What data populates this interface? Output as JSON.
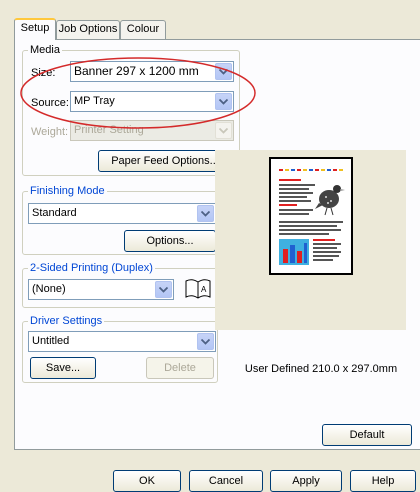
{
  "tabs": [
    "Setup",
    "Job Options",
    "Colour"
  ],
  "media": {
    "legend": "Media",
    "size_label": "Size:",
    "size_value": "Banner 297 x 1200 mm",
    "source_label": "Source:",
    "source_value": "MP Tray",
    "weight_label": "Weight:",
    "weight_value": "Printer Setting",
    "paper_feed_button": "Paper Feed Options..."
  },
  "finishing": {
    "legend": "Finishing Mode",
    "value": "Standard",
    "options_button": "Options..."
  },
  "duplex": {
    "legend": "2-Sided Printing (Duplex)",
    "value": "(None)"
  },
  "driver": {
    "legend": "Driver Settings",
    "value": "Untitled",
    "save_button": "Save...",
    "delete_button": "Delete"
  },
  "preview": {
    "caption": "User Defined 210.0 x 297.0mm"
  },
  "default_button": "Default",
  "footer": {
    "ok": "OK",
    "cancel": "Cancel",
    "apply": "Apply",
    "help": "Help"
  },
  "colors": {
    "highlight_ellipse": "#d42a2a",
    "accent_tab": "#ffc83c",
    "legend_blue": "#0046d5"
  }
}
